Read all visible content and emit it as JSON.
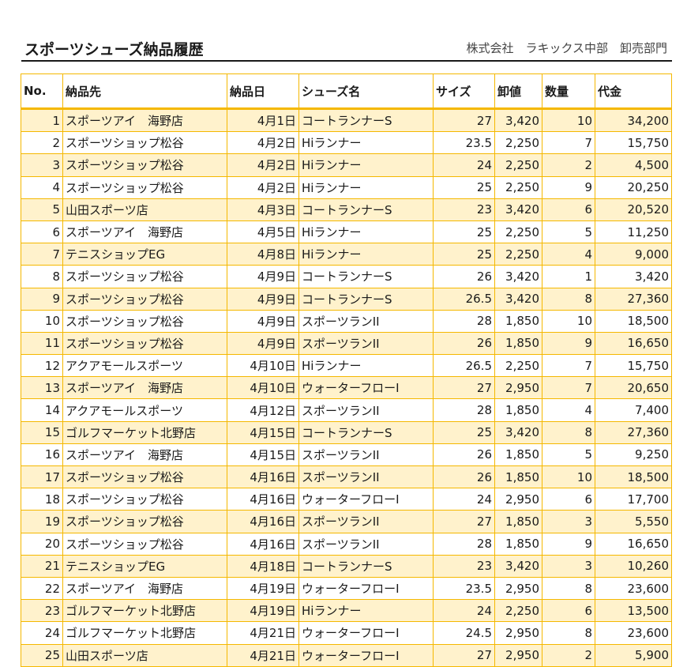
{
  "header": {
    "title": "スポーツシューズ納品履歴",
    "company": "株式会社　ラキックス中部　卸売部門"
  },
  "table": {
    "columns": [
      "No.",
      "納品先",
      "納品日",
      "シューズ名",
      "サイズ",
      "卸値",
      "数量",
      "代金"
    ],
    "rows": [
      [
        "1",
        "スポーツアイ　海野店",
        "4月1日",
        "コートランナーS",
        "27",
        "3,420",
        "10",
        "34,200"
      ],
      [
        "2",
        "スポーツショップ松谷",
        "4月2日",
        "Hiランナー",
        "23.5",
        "2,250",
        "7",
        "15,750"
      ],
      [
        "3",
        "スポーツショップ松谷",
        "4月2日",
        "Hiランナー",
        "24",
        "2,250",
        "2",
        "4,500"
      ],
      [
        "4",
        "スポーツショップ松谷",
        "4月2日",
        "Hiランナー",
        "25",
        "2,250",
        "9",
        "20,250"
      ],
      [
        "5",
        "山田スポーツ店",
        "4月3日",
        "コートランナーS",
        "23",
        "3,420",
        "6",
        "20,520"
      ],
      [
        "6",
        "スポーツアイ　海野店",
        "4月5日",
        "Hiランナー",
        "25",
        "2,250",
        "5",
        "11,250"
      ],
      [
        "7",
        "テニスショップEG",
        "4月8日",
        "Hiランナー",
        "25",
        "2,250",
        "4",
        "9,000"
      ],
      [
        "8",
        "スポーツショップ松谷",
        "4月9日",
        "コートランナーS",
        "26",
        "3,420",
        "1",
        "3,420"
      ],
      [
        "9",
        "スポーツショップ松谷",
        "4月9日",
        "コートランナーS",
        "26.5",
        "3,420",
        "8",
        "27,360"
      ],
      [
        "10",
        "スポーツショップ松谷",
        "4月9日",
        "スポーツランII",
        "28",
        "1,850",
        "10",
        "18,500"
      ],
      [
        "11",
        "スポーツショップ松谷",
        "4月9日",
        "スポーツランII",
        "26",
        "1,850",
        "9",
        "16,650"
      ],
      [
        "12",
        "アクアモールスポーツ",
        "4月10日",
        "Hiランナー",
        "26.5",
        "2,250",
        "7",
        "15,750"
      ],
      [
        "13",
        "スポーツアイ　海野店",
        "4月10日",
        "ウォーターフローI",
        "27",
        "2,950",
        "7",
        "20,650"
      ],
      [
        "14",
        "アクアモールスポーツ",
        "4月12日",
        "スポーツランII",
        "28",
        "1,850",
        "4",
        "7,400"
      ],
      [
        "15",
        "ゴルフマーケット北野店",
        "4月15日",
        "コートランナーS",
        "25",
        "3,420",
        "8",
        "27,360"
      ],
      [
        "16",
        "スポーツアイ　海野店",
        "4月15日",
        "スポーツランII",
        "26",
        "1,850",
        "5",
        "9,250"
      ],
      [
        "17",
        "スポーツショップ松谷",
        "4月16日",
        "スポーツランII",
        "26",
        "1,850",
        "10",
        "18,500"
      ],
      [
        "18",
        "スポーツショップ松谷",
        "4月16日",
        "ウォーターフローI",
        "24",
        "2,950",
        "6",
        "17,700"
      ],
      [
        "19",
        "スポーツショップ松谷",
        "4月16日",
        "スポーツランII",
        "27",
        "1,850",
        "3",
        "5,550"
      ],
      [
        "20",
        "スポーツショップ松谷",
        "4月16日",
        "スポーツランII",
        "28",
        "1,850",
        "9",
        "16,650"
      ],
      [
        "21",
        "テニスショップEG",
        "4月18日",
        "コートランナーS",
        "23",
        "3,420",
        "3",
        "10,260"
      ],
      [
        "22",
        "スポーツアイ　海野店",
        "4月19日",
        "ウォーターフローI",
        "23.5",
        "2,950",
        "8",
        "23,600"
      ],
      [
        "23",
        "ゴルフマーケット北野店",
        "4月19日",
        "Hiランナー",
        "24",
        "2,250",
        "6",
        "13,500"
      ],
      [
        "24",
        "ゴルフマーケット北野店",
        "4月21日",
        "ウォーターフローI",
        "24.5",
        "2,950",
        "8",
        "23,600"
      ],
      [
        "25",
        "山田スポーツ店",
        "4月21日",
        "ウォーターフローI",
        "27",
        "2,950",
        "2",
        "5,900"
      ]
    ]
  }
}
